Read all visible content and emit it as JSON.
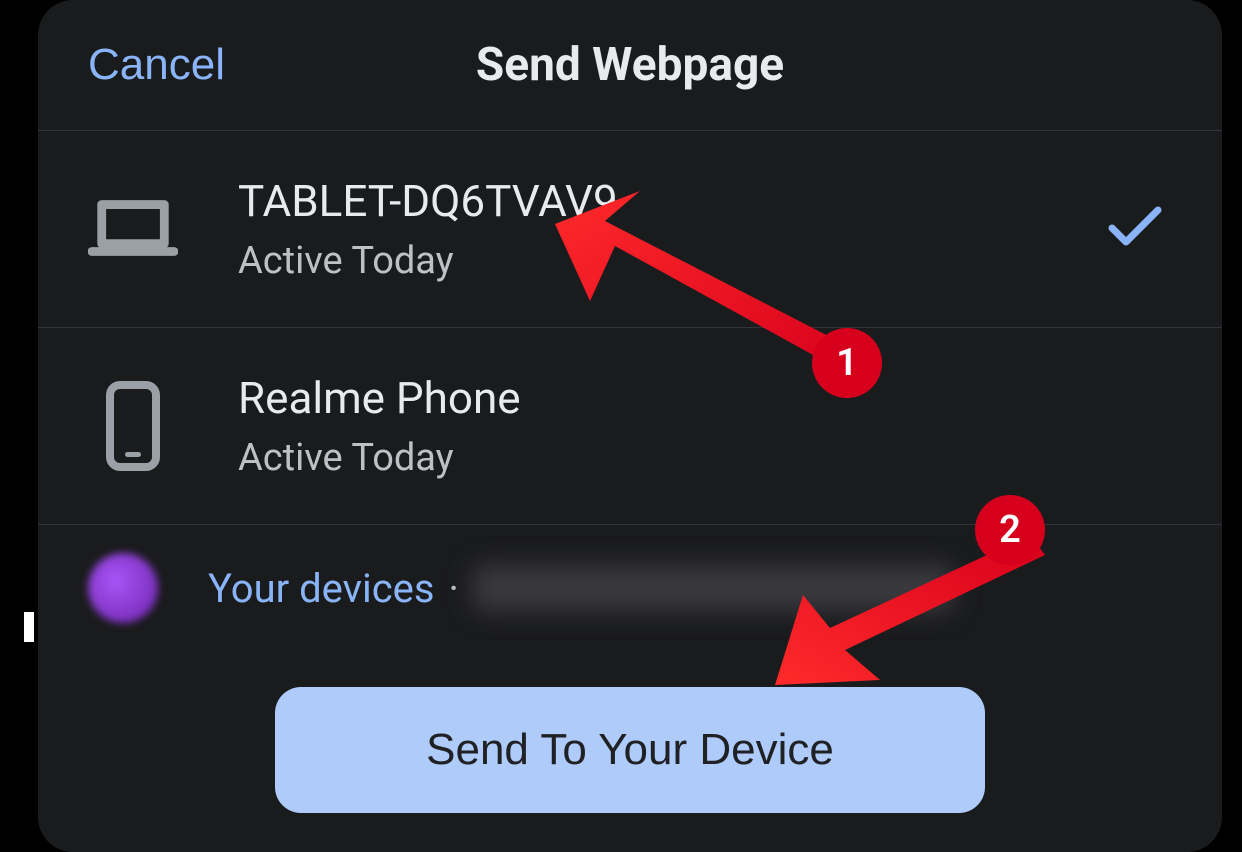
{
  "header": {
    "cancel_label": "Cancel",
    "title": "Send Webpage"
  },
  "devices": [
    {
      "icon": "laptop-icon",
      "name": "TABLET-DQ6TVAV9",
      "status": "Active Today",
      "selected": true
    },
    {
      "icon": "phone-icon",
      "name": "Realme Phone",
      "status": "Active Today",
      "selected": false
    }
  ],
  "account": {
    "your_devices_label": "Your devices",
    "separator": "·"
  },
  "send_button_label": "Send To Your Device",
  "annotations": {
    "badges": [
      "1",
      "2"
    ]
  }
}
